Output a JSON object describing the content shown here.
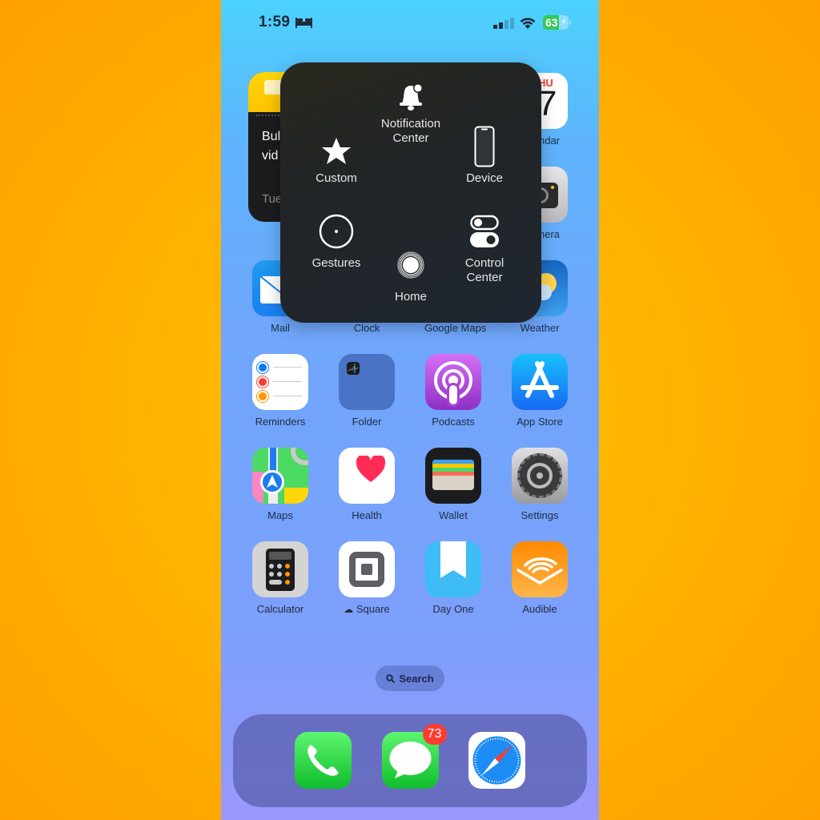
{
  "status_bar": {
    "time": "1:59",
    "focus_icon": "bed-icon",
    "signal_bars": 2,
    "signal_max": 4,
    "battery_percent": "63",
    "battery_level": 0.63,
    "charging": true
  },
  "widget": {
    "type": "notes",
    "line1": "Bul",
    "line2": "vid",
    "date": "Tue"
  },
  "apps": [
    {
      "id": "calendar",
      "label": "Calendar",
      "visible_label": "ndar",
      "day": "THU",
      "visible_day": "HU",
      "date": "7"
    },
    {
      "id": "camera",
      "label": "Camera",
      "visible_label": "nera"
    },
    {
      "id": "mail",
      "label": "Mail"
    },
    {
      "id": "clock",
      "label": "Clock"
    },
    {
      "id": "google-maps",
      "label": "Google Maps"
    },
    {
      "id": "weather",
      "label": "Weather"
    },
    {
      "id": "reminders",
      "label": "Reminders"
    },
    {
      "id": "folder",
      "label": "Folder"
    },
    {
      "id": "podcasts",
      "label": "Podcasts"
    },
    {
      "id": "app-store",
      "label": "App Store"
    },
    {
      "id": "maps",
      "label": "Maps"
    },
    {
      "id": "health",
      "label": "Health"
    },
    {
      "id": "wallet",
      "label": "Wallet"
    },
    {
      "id": "settings",
      "label": "Settings"
    },
    {
      "id": "calculator",
      "label": "Calculator"
    },
    {
      "id": "square",
      "label": "Square",
      "cloud_download": true
    },
    {
      "id": "day-one",
      "label": "Day One"
    },
    {
      "id": "audible",
      "label": "Audible"
    }
  ],
  "assistive_touch": {
    "options": [
      {
        "id": "notification-center",
        "label": "Notification Center",
        "icon": "bell-icon"
      },
      {
        "id": "custom",
        "label": "Custom",
        "icon": "star-icon"
      },
      {
        "id": "device",
        "label": "Device",
        "icon": "iphone-icon"
      },
      {
        "id": "gestures",
        "label": "Gestures",
        "icon": "circle-dot-icon"
      },
      {
        "id": "control-center",
        "label": "Control Center",
        "icon": "toggles-icon"
      },
      {
        "id": "home",
        "label": "Home",
        "icon": "home-button-icon"
      }
    ]
  },
  "search": {
    "label": "Search",
    "icon": "magnifier-icon"
  },
  "dock": [
    {
      "id": "phone",
      "label": "Phone"
    },
    {
      "id": "messages",
      "label": "Messages",
      "badge": "73"
    },
    {
      "id": "safari",
      "label": "Safari"
    }
  ],
  "colors": {
    "backdrop": "#ffb300",
    "badge": "#ff3b30",
    "battery_green": "#34c759",
    "overlay": "#1f2630"
  }
}
